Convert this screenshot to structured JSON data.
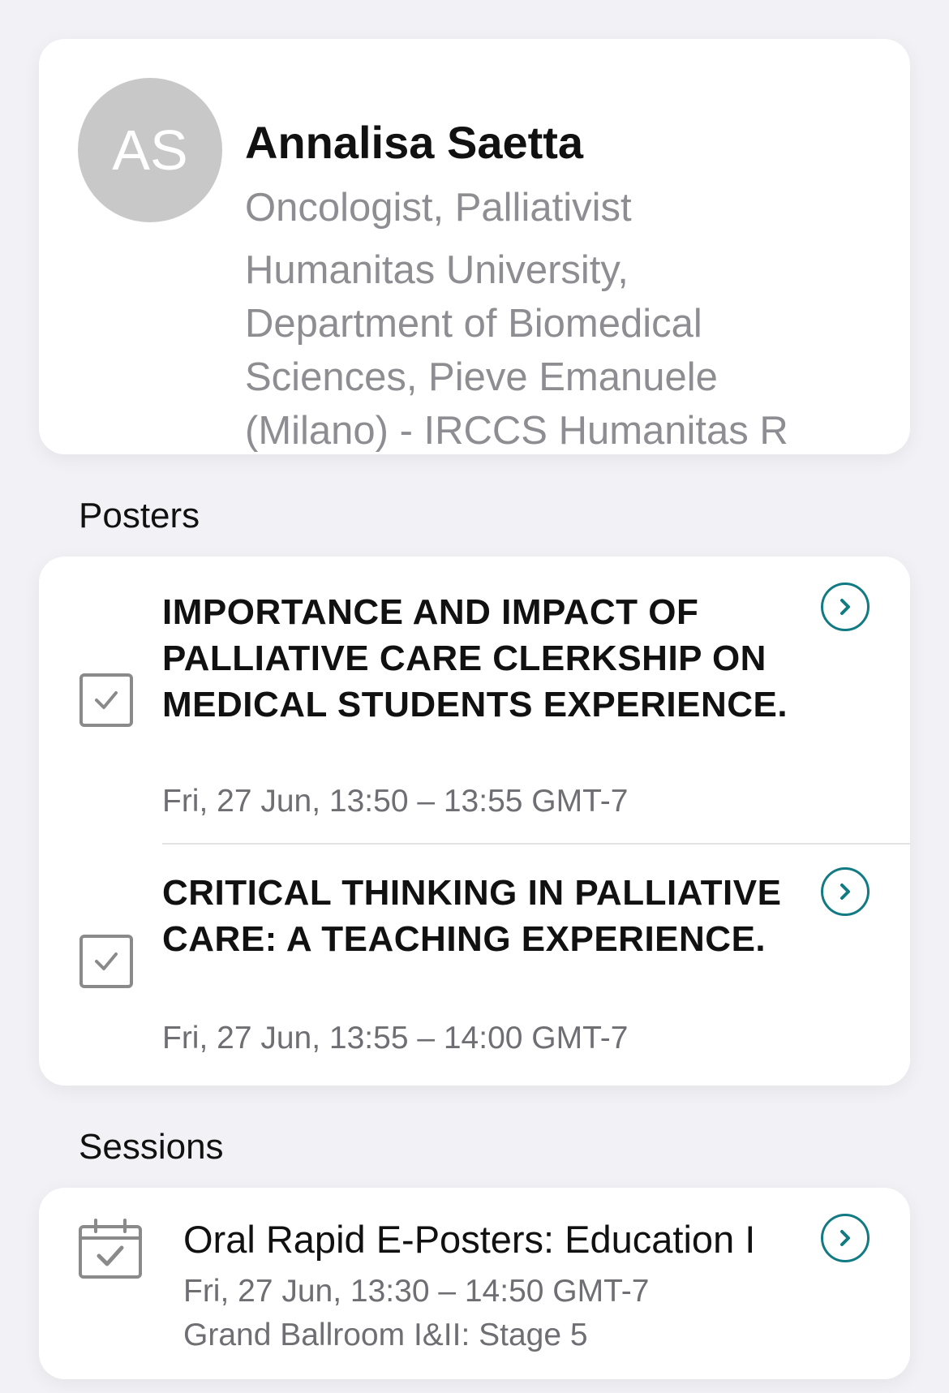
{
  "profile": {
    "initials": "AS",
    "name": "Annalisa Saetta",
    "role": "Oncologist, Palliativist",
    "affiliation": "Humanitas University,\nDepartment of Biomedical\nSciences, Pieve Emanuele\n(Milano) - IRCCS Humanitas R"
  },
  "posters": {
    "section_title": "Posters",
    "items": [
      {
        "title": "IMPORTANCE AND IMPACT OF PALLIATIVE CARE CLERKSHIP ON MEDICAL STUDENTS EXPERIENCE.",
        "time": "Fri, 27 Jun, 13:50 – 13:55 GMT-7"
      },
      {
        "title": "CRITICAL THINKING IN PALLIATIVE CARE: A TEACHING EXPERIENCE.",
        "time": "Fri, 27 Jun, 13:55 – 14:00 GMT-7"
      }
    ]
  },
  "sessions": {
    "section_title": "Sessions",
    "items": [
      {
        "title": "Oral Rapid E-Posters: Education I",
        "time": "Fri, 27 Jun, 13:30 – 14:50 GMT-7",
        "location": "Grand Ballroom I&II: Stage 5"
      }
    ]
  },
  "colors": {
    "accent": "#117a82",
    "avatar_bg": "#c8c8c8",
    "background": "#f2f2f6"
  }
}
